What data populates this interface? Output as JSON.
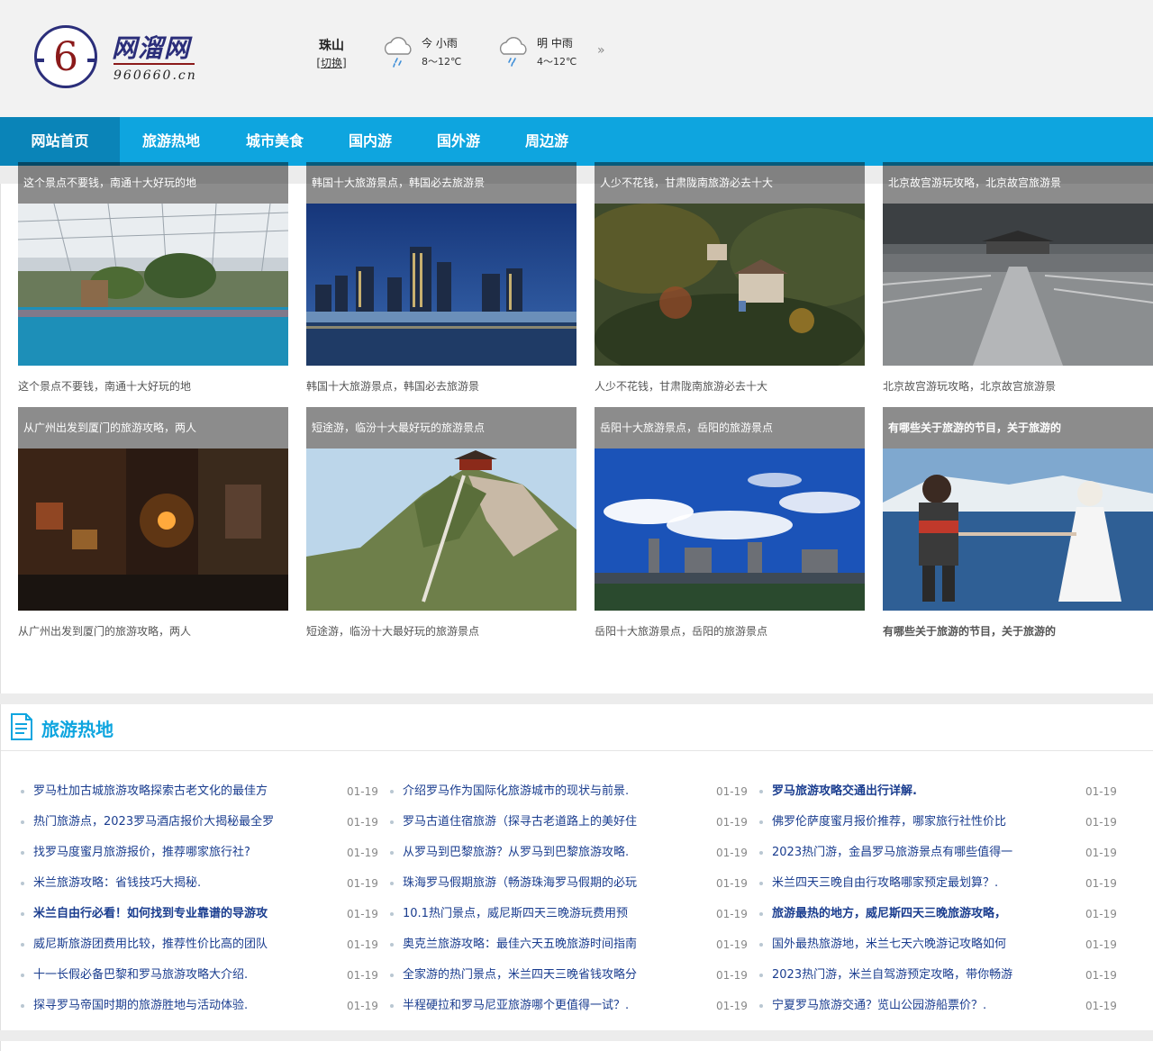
{
  "logo": {
    "number": "6",
    "text": "网溜网",
    "domain": "960660.cn"
  },
  "city": {
    "name": "珠山",
    "switch": "[切换]"
  },
  "weather": [
    {
      "label": "今 小雨",
      "temp": "8～12℃",
      "icon": "rain-cloud-icon"
    },
    {
      "label": "明 中雨",
      "temp": "4～12℃",
      "icon": "rain-cloud-icon"
    }
  ],
  "weather_more": "»",
  "nav": [
    "网站首页",
    "旅游热地",
    "城市美食",
    "国内游",
    "国外游",
    "周边游"
  ],
  "cards": [
    {
      "overlay": "这个景点不要钱，南通十大好玩的地",
      "caption": "这个景点不要钱，南通十大好玩的地"
    },
    {
      "overlay": "韩国十大旅游景点，韩国必去旅游景",
      "caption": "韩国十大旅游景点，韩国必去旅游景"
    },
    {
      "overlay": "人少不花钱，甘肃陇南旅游必去十大",
      "caption": "人少不花钱，甘肃陇南旅游必去十大"
    },
    {
      "overlay": "北京故宫游玩攻略，北京故宫旅游景",
      "caption": "北京故宫游玩攻略，北京故宫旅游景"
    },
    {
      "overlay": "从广州出发到厦门的旅游攻略，两人",
      "caption": "从广州出发到厦门的旅游攻略，两人"
    },
    {
      "overlay": "短途游，临汾十大最好玩的旅游景点",
      "caption": "短途游，临汾十大最好玩的旅游景点"
    },
    {
      "overlay": "岳阳十大旅游景点，岳阳的旅游景点",
      "caption": "岳阳十大旅游景点，岳阳的旅游景点"
    },
    {
      "overlay": "有哪些关于旅游的节目，关于旅游的",
      "caption": "有哪些关于旅游的节目，关于旅游的"
    }
  ],
  "hot": {
    "title": "旅游热地",
    "columns": [
      [
        {
          "text": "罗马杜加古城旅游攻略探索古老文化的最佳方",
          "date": "01-19"
        },
        {
          "text": "热门旅游点，2023罗马酒店报价大揭秘最全罗",
          "date": "01-19"
        },
        {
          "text": "找罗马度蜜月旅游报价，推荐哪家旅行社?",
          "date": "01-19"
        },
        {
          "text": "米兰旅游攻略：省钱技巧大揭秘.",
          "date": "01-19"
        },
        {
          "text": "米兰自由行必看！如何找到专业靠谱的导游攻",
          "date": "01-19",
          "bold": true
        },
        {
          "text": "威尼斯旅游团费用比较，推荐性价比高的团队",
          "date": "01-19"
        },
        {
          "text": "十一长假必备巴黎和罗马旅游攻略大介绍.",
          "date": "01-19"
        },
        {
          "text": "探寻罗马帝国时期的旅游胜地与活动体验.",
          "date": "01-19"
        }
      ],
      [
        {
          "text": "介绍罗马作为国际化旅游城市的现状与前景.",
          "date": "01-19"
        },
        {
          "text": "罗马古道住宿旅游（探寻古老道路上的美好住",
          "date": "01-19"
        },
        {
          "text": "从罗马到巴黎旅游？从罗马到巴黎旅游攻略.",
          "date": "01-19"
        },
        {
          "text": "珠海罗马假期旅游（畅游珠海罗马假期的必玩",
          "date": "01-19"
        },
        {
          "text": "10.1热门景点，威尼斯四天三晚游玩费用预",
          "date": "01-19"
        },
        {
          "text": "奥克兰旅游攻略：最佳六天五晚旅游时间指南",
          "date": "01-19"
        },
        {
          "text": "全家游的热门景点，米兰四天三晚省钱攻略分",
          "date": "01-19"
        },
        {
          "text": "半程硬拉和罗马尼亚旅游哪个更值得一试？.",
          "date": "01-19"
        }
      ],
      [
        {
          "text": "罗马旅游攻略交通出行详解.",
          "date": "01-19",
          "bold": true
        },
        {
          "text": "佛罗伦萨度蜜月报价推荐，哪家旅行社性价比",
          "date": "01-19"
        },
        {
          "text": "2023热门游，金昌罗马旅游景点有哪些值得一",
          "date": "01-19"
        },
        {
          "text": "米兰四天三晚自由行攻略哪家预定最划算？.",
          "date": "01-19"
        },
        {
          "text": "旅游最热的地方，威尼斯四天三晚旅游攻略，",
          "date": "01-19",
          "bold": true
        },
        {
          "text": "国外最热旅游地，米兰七天六晚游记攻略如何",
          "date": "01-19"
        },
        {
          "text": "2023热门游，米兰自驾游预定攻略，带你畅游",
          "date": "01-19"
        },
        {
          "text": "宁夏罗马旅游交通？览山公园游船票价？.",
          "date": "01-19"
        }
      ]
    ]
  }
}
